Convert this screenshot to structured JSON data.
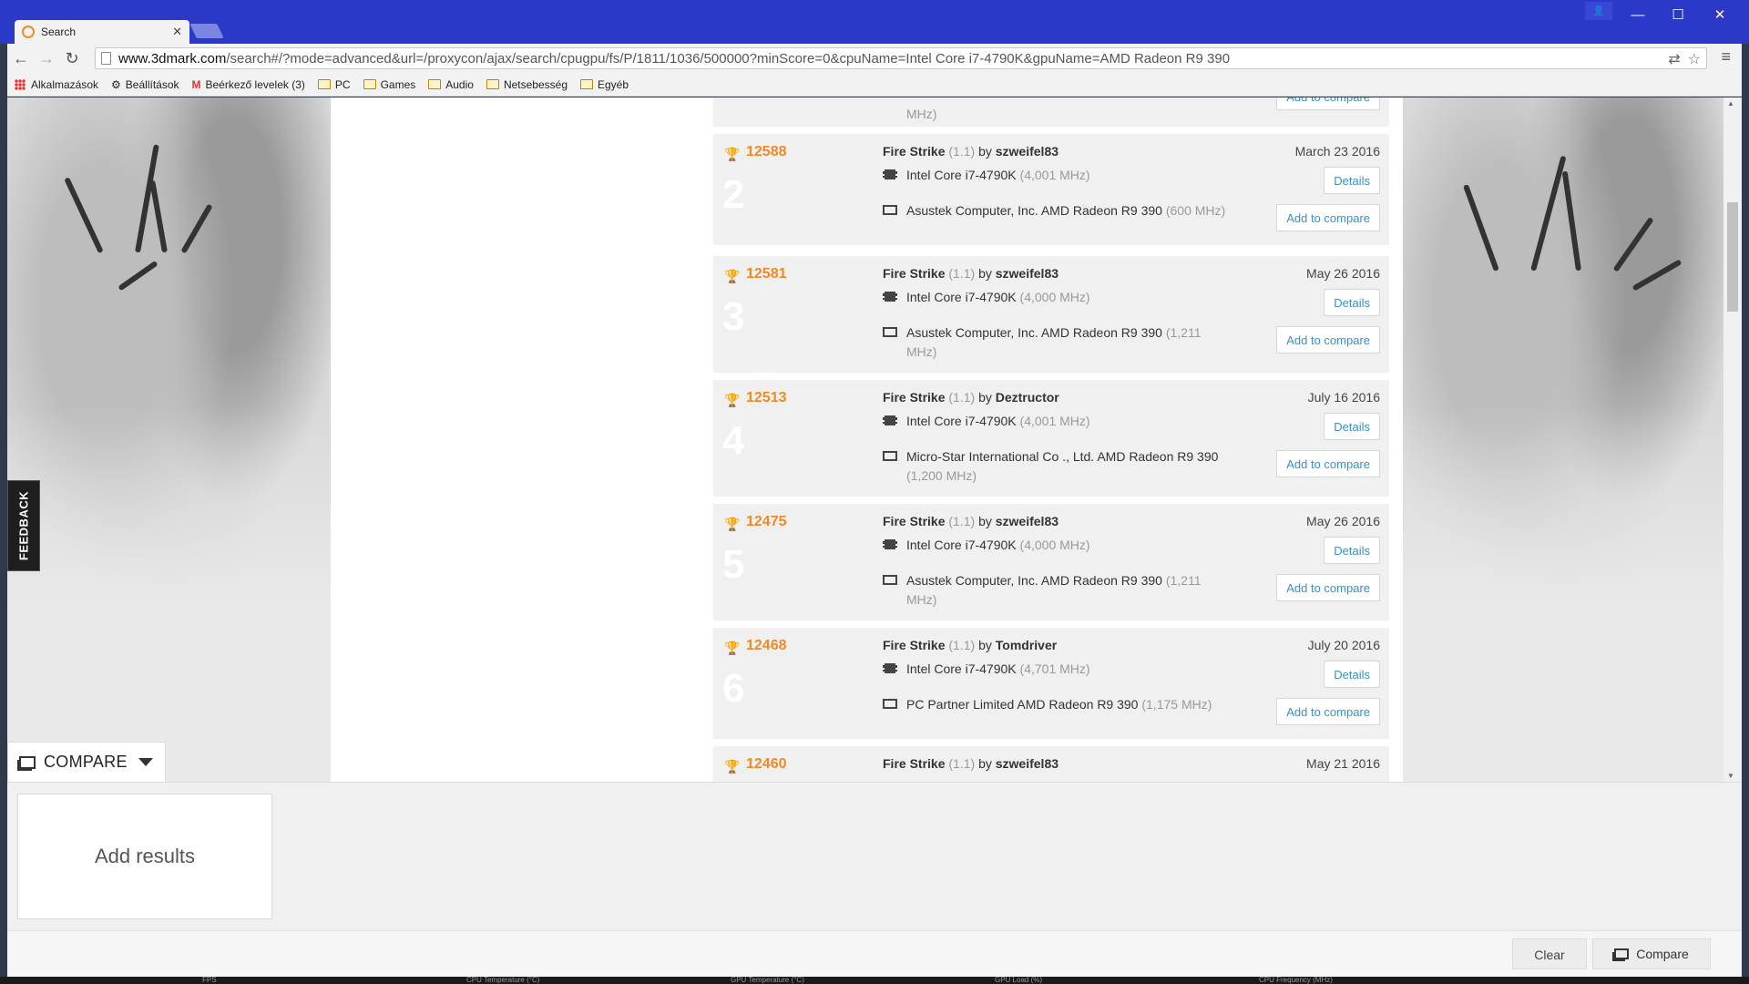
{
  "browser": {
    "tab_title": "Search",
    "url_host": "www.3dmark.com",
    "url_rest": "/search#/?mode=advanced&url=/proxycon/ajax/search/cpugpu/fs/P/1811/1036/500000?minScore=0&cpuName=Intel Core i7-4790K&gpuName=AMD Radeon R9 390",
    "bookmarks": [
      "Alkalmazások",
      "Beállítások",
      "Beérkező levelek (3)",
      "PC",
      "Games",
      "Audio",
      "Netsebesség",
      "Egyéb"
    ]
  },
  "results": [
    {
      "score": "",
      "rank": "",
      "test": "",
      "version": "",
      "by": "",
      "user": "",
      "date": "",
      "cpu": "",
      "cpu_mhz": "",
      "gpu": "",
      "gpu_mhz": "MHz)",
      "details": "",
      "compare": "Add to compare"
    },
    {
      "score": "12588",
      "rank": "2",
      "test": "Fire Strike",
      "version": "(1.1)",
      "by": "by",
      "user": "szweifel83",
      "date": "March 23 2016",
      "cpu": "Intel Core i7-4790K",
      "cpu_mhz": "(4,001 MHz)",
      "gpu": "Asustek Computer, Inc. AMD Radeon R9 390",
      "gpu_mhz": "(600 MHz)",
      "details": "Details",
      "compare": "Add to compare"
    },
    {
      "score": "12581",
      "rank": "3",
      "test": "Fire Strike",
      "version": "(1.1)",
      "by": "by",
      "user": "szweifel83",
      "date": "May 26 2016",
      "cpu": "Intel Core i7-4790K",
      "cpu_mhz": "(4,000 MHz)",
      "gpu": "Asustek Computer, Inc. AMD Radeon R9 390",
      "gpu_mhz": "(1,211 MHz)",
      "details": "Details",
      "compare": "Add to compare"
    },
    {
      "score": "12513",
      "rank": "4",
      "test": "Fire Strike",
      "version": "(1.1)",
      "by": "by",
      "user": "Deztructor",
      "date": "July 16 2016",
      "cpu": "Intel Core i7-4790K",
      "cpu_mhz": "(4,001 MHz)",
      "gpu": "Micro-Star International Co ., Ltd. AMD Radeon R9 390",
      "gpu_mhz": "(1,200 MHz)",
      "details": "Details",
      "compare": "Add to compare"
    },
    {
      "score": "12475",
      "rank": "5",
      "test": "Fire Strike",
      "version": "(1.1)",
      "by": "by",
      "user": "szweifel83",
      "date": "May 26 2016",
      "cpu": "Intel Core i7-4790K",
      "cpu_mhz": "(4,000 MHz)",
      "gpu": "Asustek Computer, Inc. AMD Radeon R9 390",
      "gpu_mhz": "(1,211 MHz)",
      "details": "Details",
      "compare": "Add to compare"
    },
    {
      "score": "12468",
      "rank": "6",
      "test": "Fire Strike",
      "version": "(1.1)",
      "by": "by",
      "user": "Tomdriver",
      "date": "July 20 2016",
      "cpu": "Intel Core i7-4790K",
      "cpu_mhz": "(4,701 MHz)",
      "gpu": "PC Partner Limited AMD Radeon R9 390",
      "gpu_mhz": "(1,175 MHz)",
      "details": "Details",
      "compare": "Add to compare"
    },
    {
      "score": "12460",
      "rank": "",
      "test": "Fire Strike",
      "version": "(1.1)",
      "by": "by",
      "user": "szweifel83",
      "date": "May 21 2016",
      "cpu": "",
      "cpu_mhz": "",
      "gpu": "",
      "gpu_mhz": "",
      "details": "",
      "compare": ""
    }
  ],
  "feedback_label": "FEEDBACK",
  "compare": {
    "tab_label": "COMPARE",
    "add_results": "Add results",
    "clear_label": "Clear",
    "compare_label": "Compare"
  },
  "monitor_strip": [
    "FPS",
    "CPU Temperature (°C)",
    "GPU Temperature (°C)",
    "GPU Load (%)",
    "CPU Frequency (MHz)"
  ],
  "colors": {
    "score": "#f08a24",
    "link": "#3b8fc5",
    "titlebar": "#2b39c9"
  }
}
